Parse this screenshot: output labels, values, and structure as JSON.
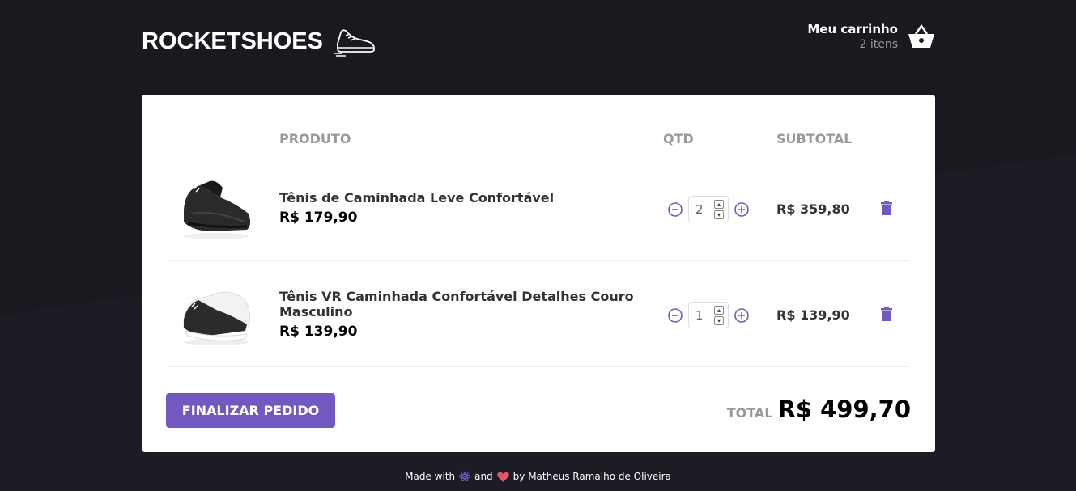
{
  "header": {
    "logo_text": "ROCKETSHOES",
    "cart_title": "Meu carrinho",
    "cart_count": "2 itens"
  },
  "table": {
    "headers": [
      "PRODUTO",
      "QTD",
      "SUBTOTAL"
    ],
    "items": [
      {
        "title": "Tênis de Caminhada Leve Confortável",
        "price": "R$ 179,90",
        "quantity": "2",
        "subtotal": "R$ 359,80"
      },
      {
        "title": "Tênis VR Caminhada Confortável Detalhes Couro Masculino",
        "price": "R$ 139,90",
        "quantity": "1",
        "subtotal": "R$ 139,90"
      }
    ]
  },
  "footer": {
    "checkout_label": "FINALIZAR PEDIDO",
    "total_label": "TOTAL",
    "total_value": "R$ 499,70"
  },
  "credits": {
    "made_with": "Made with",
    "and": "and",
    "by": "by Matheus Ramalho de Oliveira"
  },
  "colors": {
    "accent": "#7159c1",
    "background": "#191920"
  },
  "icons": {
    "logo": "sneaker-icon",
    "cart": "basket-icon",
    "decrement": "minus-circle-icon",
    "increment": "plus-circle-icon",
    "remove": "trash-icon",
    "react": "react-icon",
    "heart": "heart-icon"
  }
}
